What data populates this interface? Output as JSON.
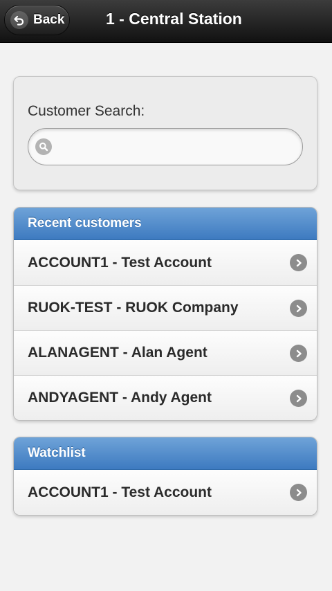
{
  "header": {
    "back_label": "Back",
    "title": "1 - Central Station"
  },
  "search": {
    "label": "Customer Search:",
    "value": "",
    "placeholder": ""
  },
  "recent": {
    "title": "Recent customers",
    "items": [
      {
        "label": "ACCOUNT1 - Test Account"
      },
      {
        "label": "RUOK-TEST - RUOK Company"
      },
      {
        "label": "ALANAGENT - Alan Agent"
      },
      {
        "label": "ANDYAGENT - Andy Agent"
      }
    ]
  },
  "watchlist": {
    "title": "Watchlist",
    "items": [
      {
        "label": "ACCOUNT1 - Test Account"
      }
    ]
  },
  "icons": {
    "back": "back-arrow-icon",
    "search": "search-icon",
    "item": "chevron-right-icon"
  },
  "colors": {
    "header_bg": "#1d1d1d",
    "list_header_bg": "#4f8ccb",
    "page_bg": "#f2f2f2"
  }
}
